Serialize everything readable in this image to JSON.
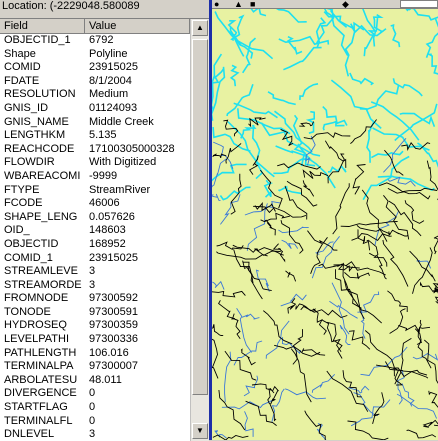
{
  "location": {
    "label": "Location:",
    "value": "(-2229048.580089"
  },
  "table": {
    "headers": {
      "field": "Field",
      "value": "Value"
    },
    "rows": [
      {
        "field": "OBJECTID_1",
        "value": "6792"
      },
      {
        "field": "Shape",
        "value": "Polyline"
      },
      {
        "field": "COMID",
        "value": "23915025"
      },
      {
        "field": "FDATE",
        "value": "8/1/2004"
      },
      {
        "field": "RESOLUTION",
        "value": "Medium"
      },
      {
        "field": "GNIS_ID",
        "value": "01124093"
      },
      {
        "field": "GNIS_NAME",
        "value": "Middle Creek"
      },
      {
        "field": "LENGTHKM",
        "value": "5.135"
      },
      {
        "field": "REACHCODE",
        "value": "17100305000328"
      },
      {
        "field": "FLOWDIR",
        "value": "With Digitized"
      },
      {
        "field": "WBAREACOMI",
        "value": "-9999"
      },
      {
        "field": "FTYPE",
        "value": "StreamRiver"
      },
      {
        "field": "FCODE",
        "value": "46006"
      },
      {
        "field": "SHAPE_LENG",
        "value": "0.057626"
      },
      {
        "field": "OID_",
        "value": "148603"
      },
      {
        "field": "OBJECTID",
        "value": "168952"
      },
      {
        "field": "COMID_1",
        "value": "23915025"
      },
      {
        "field": "STREAMLEVE",
        "value": "3"
      },
      {
        "field": "STREAMORDE",
        "value": "3"
      },
      {
        "field": "FROMNODE",
        "value": "97300592"
      },
      {
        "field": "TONODE",
        "value": "97300591"
      },
      {
        "field": "HYDROSEQ",
        "value": "97300359"
      },
      {
        "field": "LEVELPATHI",
        "value": "97300336"
      },
      {
        "field": "PATHLENGTH",
        "value": "106.016"
      },
      {
        "field": "TERMINALPA",
        "value": "97300007"
      },
      {
        "field": "ARBOLATESU",
        "value": "48.011"
      },
      {
        "field": "DIVERGENCE",
        "value": "0"
      },
      {
        "field": "STARTFLAG",
        "value": "0"
      },
      {
        "field": "TERMINALFL",
        "value": "0"
      },
      {
        "field": "DNLEVEL",
        "value": "3"
      }
    ]
  },
  "scrollbar": {
    "up_icon": "scroll-up-arrow-icon",
    "down_icon": "scroll-down-arrow-icon"
  },
  "map": {
    "colors": {
      "background": "#e8f2a2",
      "cyan_streams": "#1ee0f0",
      "black_boundaries": "#000000",
      "blue_streams": "#3a78d8",
      "divider": "#1e2fa8"
    },
    "toolbar_icons": [
      "identify-icon",
      "binoculars-icon",
      "hyperlink-icon",
      "zoom-to-icon"
    ]
  }
}
